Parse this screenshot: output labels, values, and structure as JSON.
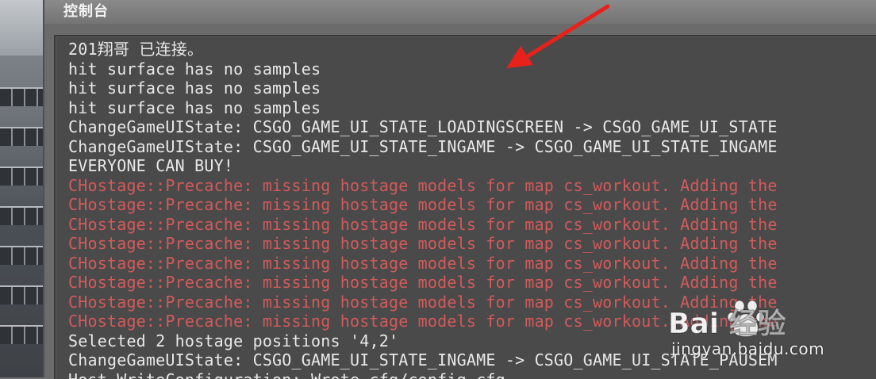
{
  "window": {
    "title": "控制台"
  },
  "console": {
    "lines": [
      {
        "text": "201翔哥 已连接。",
        "type": "info"
      },
      {
        "text": "hit surface has no samples",
        "type": "info"
      },
      {
        "text": "hit surface has no samples",
        "type": "info"
      },
      {
        "text": "hit surface has no samples",
        "type": "info"
      },
      {
        "text": "ChangeGameUIState: CSGO_GAME_UI_STATE_LOADINGSCREEN -> CSGO_GAME_UI_STATE",
        "type": "info"
      },
      {
        "text": "ChangeGameUIState: CSGO_GAME_UI_STATE_INGAME -> CSGO_GAME_UI_STATE_INGAME",
        "type": "info"
      },
      {
        "text": "EVERYONE CAN BUY!",
        "type": "info"
      },
      {
        "text": "CHostage::Precache: missing hostage models for map cs_workout. Adding the",
        "type": "error"
      },
      {
        "text": "CHostage::Precache: missing hostage models for map cs_workout. Adding the",
        "type": "error"
      },
      {
        "text": "CHostage::Precache: missing hostage models for map cs_workout. Adding the",
        "type": "error"
      },
      {
        "text": "CHostage::Precache: missing hostage models for map cs_workout. Adding the",
        "type": "error"
      },
      {
        "text": "CHostage::Precache: missing hostage models for map cs_workout. Adding the",
        "type": "error"
      },
      {
        "text": "CHostage::Precache: missing hostage models for map cs_workout. Adding the",
        "type": "error"
      },
      {
        "text": "CHostage::Precache: missing hostage models for map cs_workout. Adding the",
        "type": "error"
      },
      {
        "text": "CHostage::Precache: missing hostage models for map cs_workout. Adding the",
        "type": "error"
      },
      {
        "text": "Selected 2 hostage positions '4,2'",
        "type": "info"
      },
      {
        "text": "ChangeGameUIState: CSGO_GAME_UI_STATE_INGAME -> CSGO_GAME_UI_STATE_PAUSEM",
        "type": "info"
      },
      {
        "text": "Host_WriteConfiguration: Wrote cfg/config.cfg",
        "type": "info"
      }
    ]
  },
  "colors": {
    "info_text": "#e8e8e8",
    "error_text": "#d35a5a",
    "arrow": "#e8221b",
    "console_bg": "#4a4a4a"
  },
  "annotation": {
    "icon": "red-arrow-icon"
  },
  "watermark": {
    "logo_text": "Bai 经验",
    "url": "jingyan.baidu.com",
    "icon": "baidu-paw-icon"
  }
}
